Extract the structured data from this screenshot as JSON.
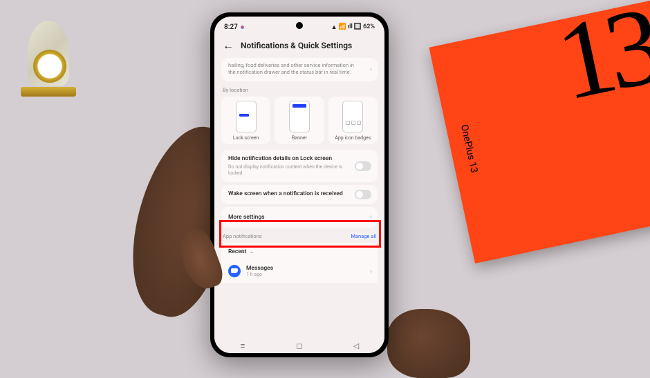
{
  "status": {
    "time": "8:27",
    "battery": "62%"
  },
  "header": {
    "title": "Notifications & Quick Settings"
  },
  "truncated": {
    "text": "hailing, food deliveries and other service information in the notification drawer and the status bar in real time."
  },
  "sections": {
    "by_location": "By location",
    "app_notifications": "App notifications",
    "manage_all": "Manage all"
  },
  "locations": [
    {
      "label": "Lock screen"
    },
    {
      "label": "Banner"
    },
    {
      "label": "App icon badges"
    }
  ],
  "settings": {
    "hide_details": {
      "title": "Hide notification details on Lock screen",
      "desc": "Do not display notification content when the device is locked."
    },
    "wake_screen": {
      "title": "Wake screen when a notification is received"
    },
    "more": "More settings"
  },
  "tabs": {
    "recent": "Recent"
  },
  "apps": {
    "messages": {
      "name": "Messages",
      "time": "1 h ago"
    }
  },
  "box": {
    "brand": "OnePlus 13",
    "num": "13"
  }
}
